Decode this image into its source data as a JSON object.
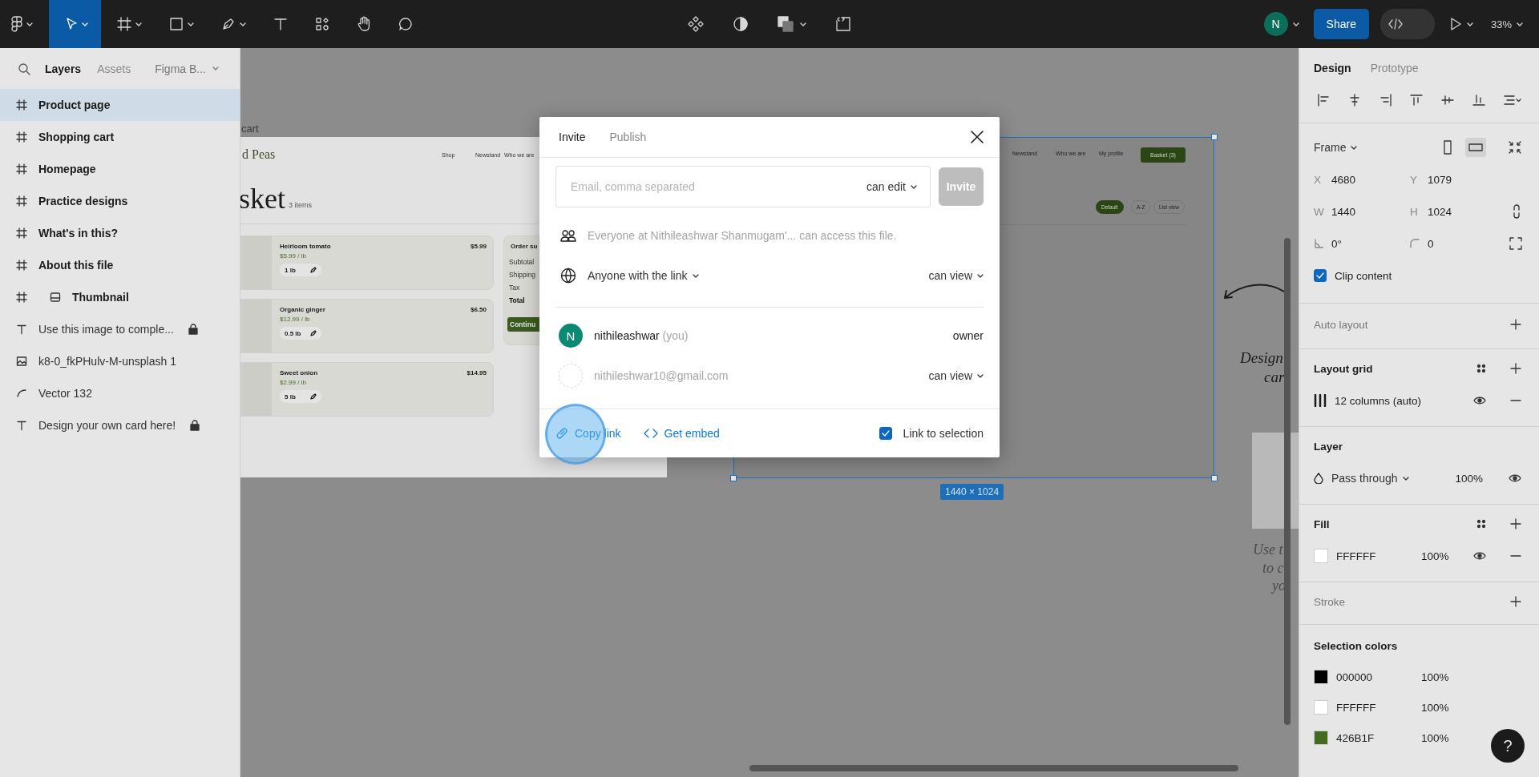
{
  "toolbar": {
    "tools": [
      {
        "kind": "move",
        "selected": true
      },
      {
        "kind": "frame",
        "selected": false
      },
      {
        "kind": "shape",
        "selected": false
      },
      {
        "kind": "pen",
        "selected": false
      },
      {
        "kind": "text",
        "selected": false
      },
      {
        "kind": "resources",
        "selected": false
      },
      {
        "kind": "hand",
        "selected": false
      },
      {
        "kind": "comment",
        "selected": false
      }
    ],
    "avatar": "N",
    "share": "Share",
    "dev_mode": false,
    "zoom": "33%"
  },
  "layers_panel": {
    "tabs": [
      {
        "label": "Layers",
        "selected": true
      },
      {
        "label": "Assets",
        "selected": false
      }
    ],
    "page": "Figma B...",
    "layers": [
      {
        "name": "Product page",
        "kind": "frame",
        "selected": true,
        "locked": false
      },
      {
        "name": "Shopping cart",
        "kind": "frame",
        "selected": false,
        "locked": false
      },
      {
        "name": "Homepage",
        "kind": "frame",
        "selected": false,
        "locked": false
      },
      {
        "name": "Practice designs",
        "kind": "frame",
        "selected": false,
        "locked": false
      },
      {
        "name": "What's in this?",
        "kind": "frame",
        "selected": false,
        "locked": false
      },
      {
        "name": "About this file",
        "kind": "frame",
        "selected": false,
        "locked": false
      },
      {
        "name": "Thumbnail",
        "kind": "thumbnail",
        "selected": false,
        "locked": false
      },
      {
        "name": "Use this image to comple...",
        "kind": "text",
        "selected": false,
        "locked": true
      },
      {
        "name": "k8-0_fkPHulv-M-unsplash 1",
        "kind": "image",
        "selected": false,
        "locked": false
      },
      {
        "name": "Vector 132",
        "kind": "vector",
        "selected": false,
        "locked": false
      },
      {
        "name": "Design your own card here!",
        "kind": "text",
        "selected": false,
        "locked": true
      }
    ]
  },
  "canvas": {
    "cart_frame": {
      "label": "cart",
      "brand": "d Peas",
      "nav": [
        "Shop",
        "Newstand",
        "Who we are"
      ],
      "heading": "sket",
      "count": "3 items",
      "items": [
        {
          "name": "Heirloom tomato",
          "unit_price": "$5.99 / lb",
          "quantity": "1 lb",
          "price": "$5.99"
        },
        {
          "name": "Organic ginger",
          "unit_price": "$12.99 / lb",
          "quantity": "0.5 lb",
          "price": "$6.50"
        },
        {
          "name": "Sweet onion",
          "unit_price": "$2.99 / lb",
          "quantity": "5 lb",
          "price": "$14.95"
        }
      ],
      "summary": {
        "title": "Order su",
        "rows": [
          "Subtotal",
          "Shipping",
          "Tax",
          "Total"
        ],
        "button": "Continu"
      }
    },
    "product_frame": {
      "nav": [
        "Newstand",
        "Who we are",
        "My profile"
      ],
      "basket": "Basket (3)",
      "chips": [
        {
          "label": "Default",
          "selected": true
        },
        {
          "label": "A-Z",
          "selected": false
        },
        {
          "label": "List view",
          "selected": false
        }
      ],
      "size": "1440 × 1024"
    },
    "notes": [
      {
        "lines": [
          "Design",
          "car"
        ]
      },
      {
        "lines": [
          "Use t",
          "to c",
          "yo"
        ]
      }
    ]
  },
  "share_dialog": {
    "tabs": [
      {
        "label": "Invite",
        "selected": true
      },
      {
        "label": "Publish",
        "selected": false
      }
    ],
    "email_placeholder": "Email, comma separated",
    "role": "can edit",
    "invite_button": {
      "label": "Invite",
      "disabled": true
    },
    "org_notice": "Everyone at Nithileashwar Shanmugam'... can access this file.",
    "link_access": {
      "label": "Anyone with the link",
      "role": "can view"
    },
    "people": [
      {
        "kind": "member",
        "initial": "N",
        "name": "nithileashwar",
        "note": "(you)",
        "role": "owner"
      },
      {
        "kind": "pending",
        "name": "nithileshwar10@gmail.com",
        "role": "can view"
      }
    ],
    "copy_link": "Copy link",
    "get_embed": "Get embed",
    "link_to_selection": {
      "label": "Link to selection",
      "checked": true
    }
  },
  "design_panel": {
    "tabs": [
      {
        "label": "Design",
        "selected": true
      },
      {
        "label": "Prototype",
        "selected": false
      }
    ],
    "frame_label": "Frame",
    "orientation": [
      {
        "kind": "portrait",
        "selected": false
      },
      {
        "kind": "landscape",
        "selected": true
      }
    ],
    "position": [
      {
        "label": "X",
        "value": "4680"
      },
      {
        "label": "Y",
        "value": "1079"
      },
      {
        "label": "W",
        "value": "1440"
      },
      {
        "label": "H",
        "value": "1024"
      }
    ],
    "rotation": "0°",
    "radius": "0",
    "clip_content": {
      "label": "Clip content",
      "checked": true
    },
    "auto_layout": "Auto layout",
    "layout_grid": {
      "title": "Layout grid",
      "grids": [
        "12 columns (auto)"
      ]
    },
    "layer": {
      "title": "Layer",
      "blend": "Pass through",
      "opacity": "100%"
    },
    "fill": {
      "title": "Fill",
      "fills": [
        {
          "hex": "FFFFFF",
          "opacity": "100%",
          "color": "#ffffff"
        }
      ]
    },
    "stroke": "Stroke",
    "selection_colors": {
      "title": "Selection colors",
      "colors": [
        {
          "hex": "000000",
          "opacity": "100%",
          "color": "#000000"
        },
        {
          "hex": "FFFFFF",
          "opacity": "100%",
          "color": "#ffffff"
        },
        {
          "hex": "426B1F",
          "opacity": "100%",
          "color": "#426b1f"
        }
      ]
    },
    "help": "?"
  }
}
